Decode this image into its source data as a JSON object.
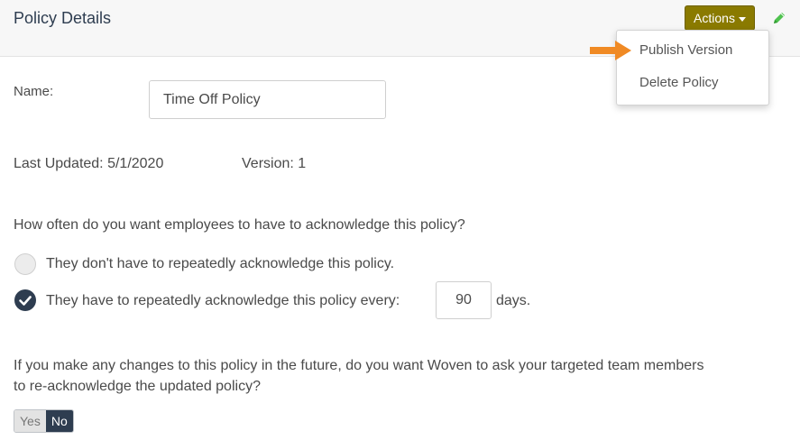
{
  "header": {
    "title": "Policy Details",
    "actions_label": "Actions",
    "actions_menu": [
      "Publish Version",
      "Delete Policy"
    ],
    "edit_icon": "pencil-icon",
    "edit_icon_color": "#4fc24f"
  },
  "form": {
    "name_label": "Name:",
    "name_value": "Time Off Policy",
    "last_updated": "Last Updated: 5/1/2020",
    "version": "Version: 1",
    "frequency_question": "How often do you want employees to have to acknowledge this policy?",
    "option_no_repeat": "They don't have to repeatedly acknowledge this policy.",
    "option_repeat": "They have to repeatedly acknowledge this policy every:",
    "days_value": "90",
    "days_suffix": "days.",
    "selected_option": "repeat",
    "reack_question_line1": "If you make any changes to this policy in the future, do you want Woven to ask your targeted team members",
    "reack_question_line2": "to re-acknowledge the updated policy?",
    "toggle_yes": "Yes",
    "toggle_no": "No",
    "toggle_selected": "No"
  },
  "colors": {
    "actions_button": "#8a7a00",
    "primary_dark": "#2e3d50",
    "arrow": "#f08a24"
  }
}
